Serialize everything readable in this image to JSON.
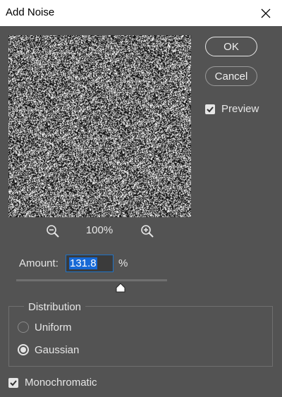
{
  "dialog": {
    "title": "Add Noise",
    "close_icon": "close-icon"
  },
  "preview": {
    "zoom_out_icon": "zoom-out-icon",
    "zoom_in_icon": "zoom-in-icon",
    "zoom_level": "100%"
  },
  "buttons": {
    "ok_label": "OK",
    "cancel_label": "Cancel"
  },
  "preview_toggle": {
    "label": "Preview",
    "checked": true
  },
  "amount": {
    "label": "Amount:",
    "value": "131.8",
    "unit": "%",
    "slider_level_percent": 70
  },
  "distribution": {
    "legend": "Distribution",
    "options": [
      {
        "label": "Uniform",
        "selected": false
      },
      {
        "label": "Gaussian",
        "selected": true
      }
    ]
  },
  "monochromatic": {
    "label": "Monochromatic",
    "checked": true
  },
  "colors": {
    "background": "#535353",
    "title_bar": "#ffffff",
    "text": "#e6e6e6",
    "input_selection": "#1769d6",
    "input_border": "#1f73c6"
  }
}
